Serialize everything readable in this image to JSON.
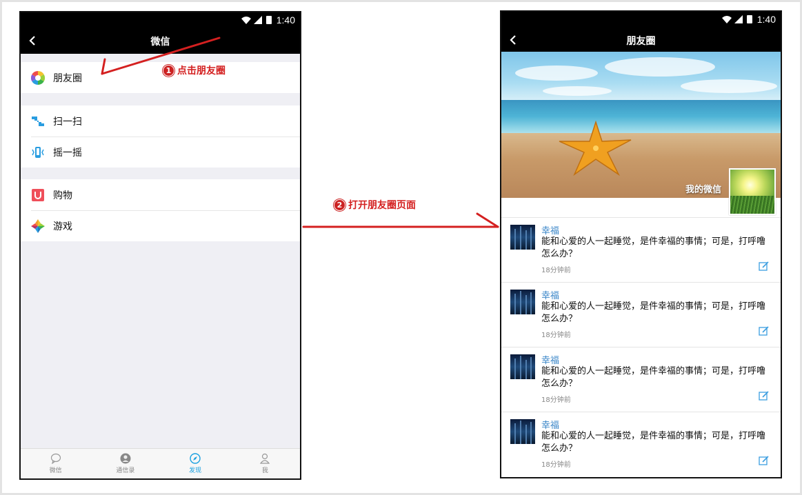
{
  "left_phone": {
    "status_time": "1:40",
    "title": "微信",
    "groups": [
      {
        "items": [
          {
            "label": "朋友圈",
            "icon": "moments-icon"
          }
        ]
      },
      {
        "items": [
          {
            "label": "扫一扫",
            "icon": "scan-icon"
          },
          {
            "label": "摇一摇",
            "icon": "shake-icon"
          }
        ]
      },
      {
        "items": [
          {
            "label": "购物",
            "icon": "shopping-icon"
          },
          {
            "label": "游戏",
            "icon": "game-icon"
          }
        ]
      }
    ],
    "tabs": [
      {
        "label": "微信",
        "icon": "chat-icon",
        "active": false
      },
      {
        "label": "通信录",
        "icon": "contacts-icon",
        "active": false
      },
      {
        "label": "发现",
        "icon": "discover-icon",
        "active": true
      },
      {
        "label": "我",
        "icon": "me-icon",
        "active": false
      }
    ]
  },
  "annotations": {
    "step1": {
      "num": "1",
      "text": "点击朋友圈"
    },
    "step2": {
      "num": "2",
      "text": "打开朋友圈页面"
    },
    "color": "#d42020"
  },
  "right_phone": {
    "status_time": "1:40",
    "title": "朋友圈",
    "banner_label": "我的微信",
    "posts": [
      {
        "name": "幸福",
        "text": "能和心爱的人一起睡觉，是件幸福的事情；可是，打呼噜怎么办？",
        "time": "18分钟前"
      },
      {
        "name": "幸福",
        "text": "能和心爱的人一起睡觉，是件幸福的事情；可是，打呼噜怎么办？",
        "time": "18分钟前"
      },
      {
        "name": "幸福",
        "text": "能和心爱的人一起睡觉，是件幸福的事情；可是，打呼噜怎么办？",
        "time": "18分钟前"
      },
      {
        "name": "幸福",
        "text": "能和心爱的人一起睡觉，是件幸福的事情；可是，打呼噜怎么办？",
        "time": "18分钟前"
      }
    ]
  },
  "colors": {
    "accent": "#1aa0e0",
    "name_link": "#3a86c8",
    "annotation": "#d42020"
  }
}
